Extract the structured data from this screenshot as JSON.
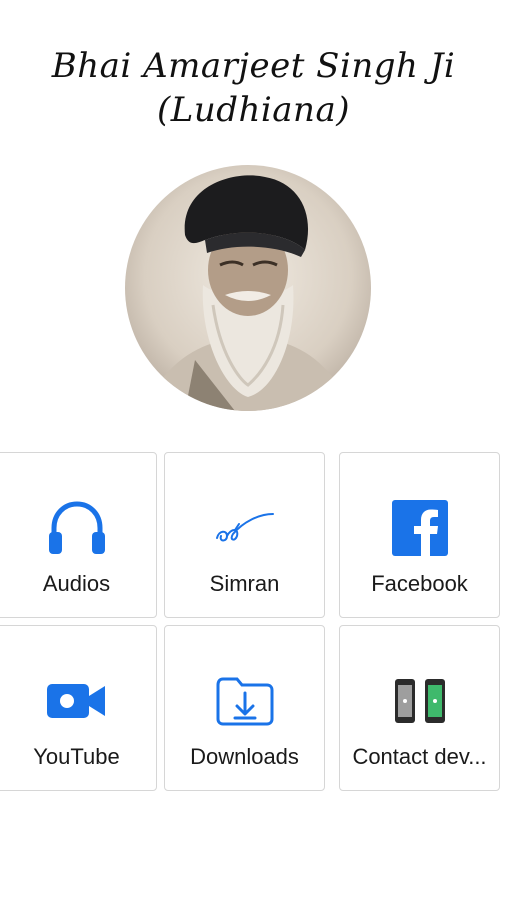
{
  "header": {
    "title_line1": "Bhai Amarjeet Singh Ji",
    "title_line2": "(Ludhiana)"
  },
  "accent_color": "#1a73e8",
  "tiles": [
    {
      "label": "Audios",
      "icon": "headphones-icon"
    },
    {
      "label": "Simran",
      "icon": "ik-onkar-icon"
    },
    {
      "label": "Facebook",
      "icon": "facebook-icon"
    },
    {
      "label": "YouTube",
      "icon": "video-camera-icon"
    },
    {
      "label": "Downloads",
      "icon": "download-folder-icon"
    },
    {
      "label": "Contact dev...",
      "icon": "phones-icon"
    }
  ]
}
